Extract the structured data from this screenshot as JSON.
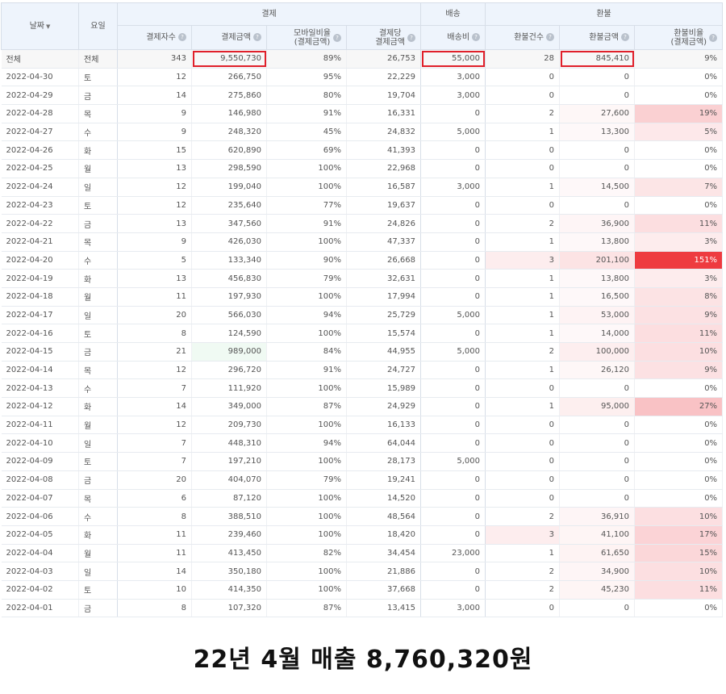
{
  "headers": {
    "date": "날짜",
    "day": "요일",
    "group_payment": "결제",
    "group_shipping": "배송",
    "group_refund": "환불",
    "pay_count": "결제자수",
    "pay_amount": "결제금액",
    "mobile_ratio_line1": "모바일비율",
    "mobile_ratio_line2": "(결제금액)",
    "per_payment_line1": "결제당",
    "per_payment_line2": "결제금액",
    "shipping_fee": "배송비",
    "refund_count": "환불건수",
    "refund_amount": "환불금액",
    "refund_ratio_line1": "환불비율",
    "refund_ratio_line2": "(결제금액)",
    "help": "?"
  },
  "total": {
    "date": "전체",
    "day": "전체",
    "pay_count": "343",
    "pay_amount": "9,550,730",
    "mobile": "89%",
    "per": "26,753",
    "ship": "55,000",
    "rcnt": "28",
    "ramt": "845,410",
    "rratio": "9%"
  },
  "rows": [
    {
      "date": "2022-04-30",
      "day": "토",
      "cnt": "12",
      "amt": "266,750",
      "mob": "95%",
      "per": "22,229",
      "ship": "3,000",
      "rcnt": "0",
      "ramt": "0",
      "rr": "0%"
    },
    {
      "date": "2022-04-29",
      "day": "금",
      "cnt": "14",
      "amt": "275,860",
      "mob": "80%",
      "per": "19,704",
      "ship": "3,000",
      "rcnt": "0",
      "ramt": "0",
      "rr": "0%"
    },
    {
      "date": "2022-04-28",
      "day": "목",
      "cnt": "9",
      "amt": "146,980",
      "mob": "91%",
      "per": "16,331",
      "ship": "0",
      "rcnt": "2",
      "ramt": "27,600",
      "rr": "19%"
    },
    {
      "date": "2022-04-27",
      "day": "수",
      "cnt": "9",
      "amt": "248,320",
      "mob": "45%",
      "per": "24,832",
      "ship": "5,000",
      "rcnt": "1",
      "ramt": "13,300",
      "rr": "5%"
    },
    {
      "date": "2022-04-26",
      "day": "화",
      "cnt": "15",
      "amt": "620,890",
      "mob": "69%",
      "per": "41,393",
      "ship": "0",
      "rcnt": "0",
      "ramt": "0",
      "rr": "0%"
    },
    {
      "date": "2022-04-25",
      "day": "월",
      "cnt": "13",
      "amt": "298,590",
      "mob": "100%",
      "per": "22,968",
      "ship": "0",
      "rcnt": "0",
      "ramt": "0",
      "rr": "0%"
    },
    {
      "date": "2022-04-24",
      "day": "일",
      "cnt": "12",
      "amt": "199,040",
      "mob": "100%",
      "per": "16,587",
      "ship": "3,000",
      "rcnt": "1",
      "ramt": "14,500",
      "rr": "7%"
    },
    {
      "date": "2022-04-23",
      "day": "토",
      "cnt": "12",
      "amt": "235,640",
      "mob": "77%",
      "per": "19,637",
      "ship": "0",
      "rcnt": "0",
      "ramt": "0",
      "rr": "0%"
    },
    {
      "date": "2022-04-22",
      "day": "금",
      "cnt": "13",
      "amt": "347,560",
      "mob": "91%",
      "per": "24,826",
      "ship": "0",
      "rcnt": "2",
      "ramt": "36,900",
      "rr": "11%"
    },
    {
      "date": "2022-04-21",
      "day": "목",
      "cnt": "9",
      "amt": "426,030",
      "mob": "100%",
      "per": "47,337",
      "ship": "0",
      "rcnt": "1",
      "ramt": "13,800",
      "rr": "3%"
    },
    {
      "date": "2022-04-20",
      "day": "수",
      "cnt": "5",
      "amt": "133,340",
      "mob": "90%",
      "per": "26,668",
      "ship": "0",
      "rcnt": "3",
      "ramt": "201,100",
      "rr": "151%"
    },
    {
      "date": "2022-04-19",
      "day": "화",
      "cnt": "13",
      "amt": "456,830",
      "mob": "79%",
      "per": "32,631",
      "ship": "0",
      "rcnt": "1",
      "ramt": "13,800",
      "rr": "3%"
    },
    {
      "date": "2022-04-18",
      "day": "월",
      "cnt": "11",
      "amt": "197,930",
      "mob": "100%",
      "per": "17,994",
      "ship": "0",
      "rcnt": "1",
      "ramt": "16,500",
      "rr": "8%"
    },
    {
      "date": "2022-04-17",
      "day": "일",
      "cnt": "20",
      "amt": "566,030",
      "mob": "94%",
      "per": "25,729",
      "ship": "5,000",
      "rcnt": "1",
      "ramt": "53,000",
      "rr": "9%"
    },
    {
      "date": "2022-04-16",
      "day": "토",
      "cnt": "8",
      "amt": "124,590",
      "mob": "100%",
      "per": "15,574",
      "ship": "0",
      "rcnt": "1",
      "ramt": "14,000",
      "rr": "11%"
    },
    {
      "date": "2022-04-15",
      "day": "금",
      "cnt": "21",
      "amt": "989,000",
      "mob": "84%",
      "per": "44,955",
      "ship": "5,000",
      "rcnt": "2",
      "ramt": "100,000",
      "rr": "10%"
    },
    {
      "date": "2022-04-14",
      "day": "목",
      "cnt": "12",
      "amt": "296,720",
      "mob": "91%",
      "per": "24,727",
      "ship": "0",
      "rcnt": "1",
      "ramt": "26,120",
      "rr": "9%"
    },
    {
      "date": "2022-04-13",
      "day": "수",
      "cnt": "7",
      "amt": "111,920",
      "mob": "100%",
      "per": "15,989",
      "ship": "0",
      "rcnt": "0",
      "ramt": "0",
      "rr": "0%"
    },
    {
      "date": "2022-04-12",
      "day": "화",
      "cnt": "14",
      "amt": "349,000",
      "mob": "87%",
      "per": "24,929",
      "ship": "0",
      "rcnt": "1",
      "ramt": "95,000",
      "rr": "27%"
    },
    {
      "date": "2022-04-11",
      "day": "월",
      "cnt": "12",
      "amt": "209,730",
      "mob": "100%",
      "per": "16,133",
      "ship": "0",
      "rcnt": "0",
      "ramt": "0",
      "rr": "0%"
    },
    {
      "date": "2022-04-10",
      "day": "일",
      "cnt": "7",
      "amt": "448,310",
      "mob": "94%",
      "per": "64,044",
      "ship": "0",
      "rcnt": "0",
      "ramt": "0",
      "rr": "0%"
    },
    {
      "date": "2022-04-09",
      "day": "토",
      "cnt": "7",
      "amt": "197,210",
      "mob": "100%",
      "per": "28,173",
      "ship": "5,000",
      "rcnt": "0",
      "ramt": "0",
      "rr": "0%"
    },
    {
      "date": "2022-04-08",
      "day": "금",
      "cnt": "20",
      "amt": "404,070",
      "mob": "79%",
      "per": "19,241",
      "ship": "0",
      "rcnt": "0",
      "ramt": "0",
      "rr": "0%"
    },
    {
      "date": "2022-04-07",
      "day": "목",
      "cnt": "6",
      "amt": "87,120",
      "mob": "100%",
      "per": "14,520",
      "ship": "0",
      "rcnt": "0",
      "ramt": "0",
      "rr": "0%"
    },
    {
      "date": "2022-04-06",
      "day": "수",
      "cnt": "8",
      "amt": "388,510",
      "mob": "100%",
      "per": "48,564",
      "ship": "0",
      "rcnt": "2",
      "ramt": "36,910",
      "rr": "10%"
    },
    {
      "date": "2022-04-05",
      "day": "화",
      "cnt": "11",
      "amt": "239,460",
      "mob": "100%",
      "per": "18,420",
      "ship": "0",
      "rcnt": "3",
      "ramt": "41,100",
      "rr": "17%"
    },
    {
      "date": "2022-04-04",
      "day": "월",
      "cnt": "11",
      "amt": "413,450",
      "mob": "82%",
      "per": "34,454",
      "ship": "23,000",
      "rcnt": "1",
      "ramt": "61,650",
      "rr": "15%"
    },
    {
      "date": "2022-04-03",
      "day": "일",
      "cnt": "14",
      "amt": "350,180",
      "mob": "100%",
      "per": "21,886",
      "ship": "0",
      "rcnt": "2",
      "ramt": "34,900",
      "rr": "10%"
    },
    {
      "date": "2022-04-02",
      "day": "토",
      "cnt": "10",
      "amt": "414,350",
      "mob": "100%",
      "per": "37,668",
      "ship": "0",
      "rcnt": "2",
      "ramt": "45,230",
      "rr": "11%"
    },
    {
      "date": "2022-04-01",
      "day": "금",
      "cnt": "8",
      "amt": "107,320",
      "mob": "87%",
      "per": "13,415",
      "ship": "3,000",
      "rcnt": "0",
      "ramt": "0",
      "rr": "0%"
    }
  ],
  "caption": "22년 4월 매출 8,760,320원",
  "colors": {
    "highlight_box": "#e0202a",
    "header_bg": "#eef4fc",
    "heat_red": "#ee3b40",
    "heat_green": "#f0faf3"
  }
}
